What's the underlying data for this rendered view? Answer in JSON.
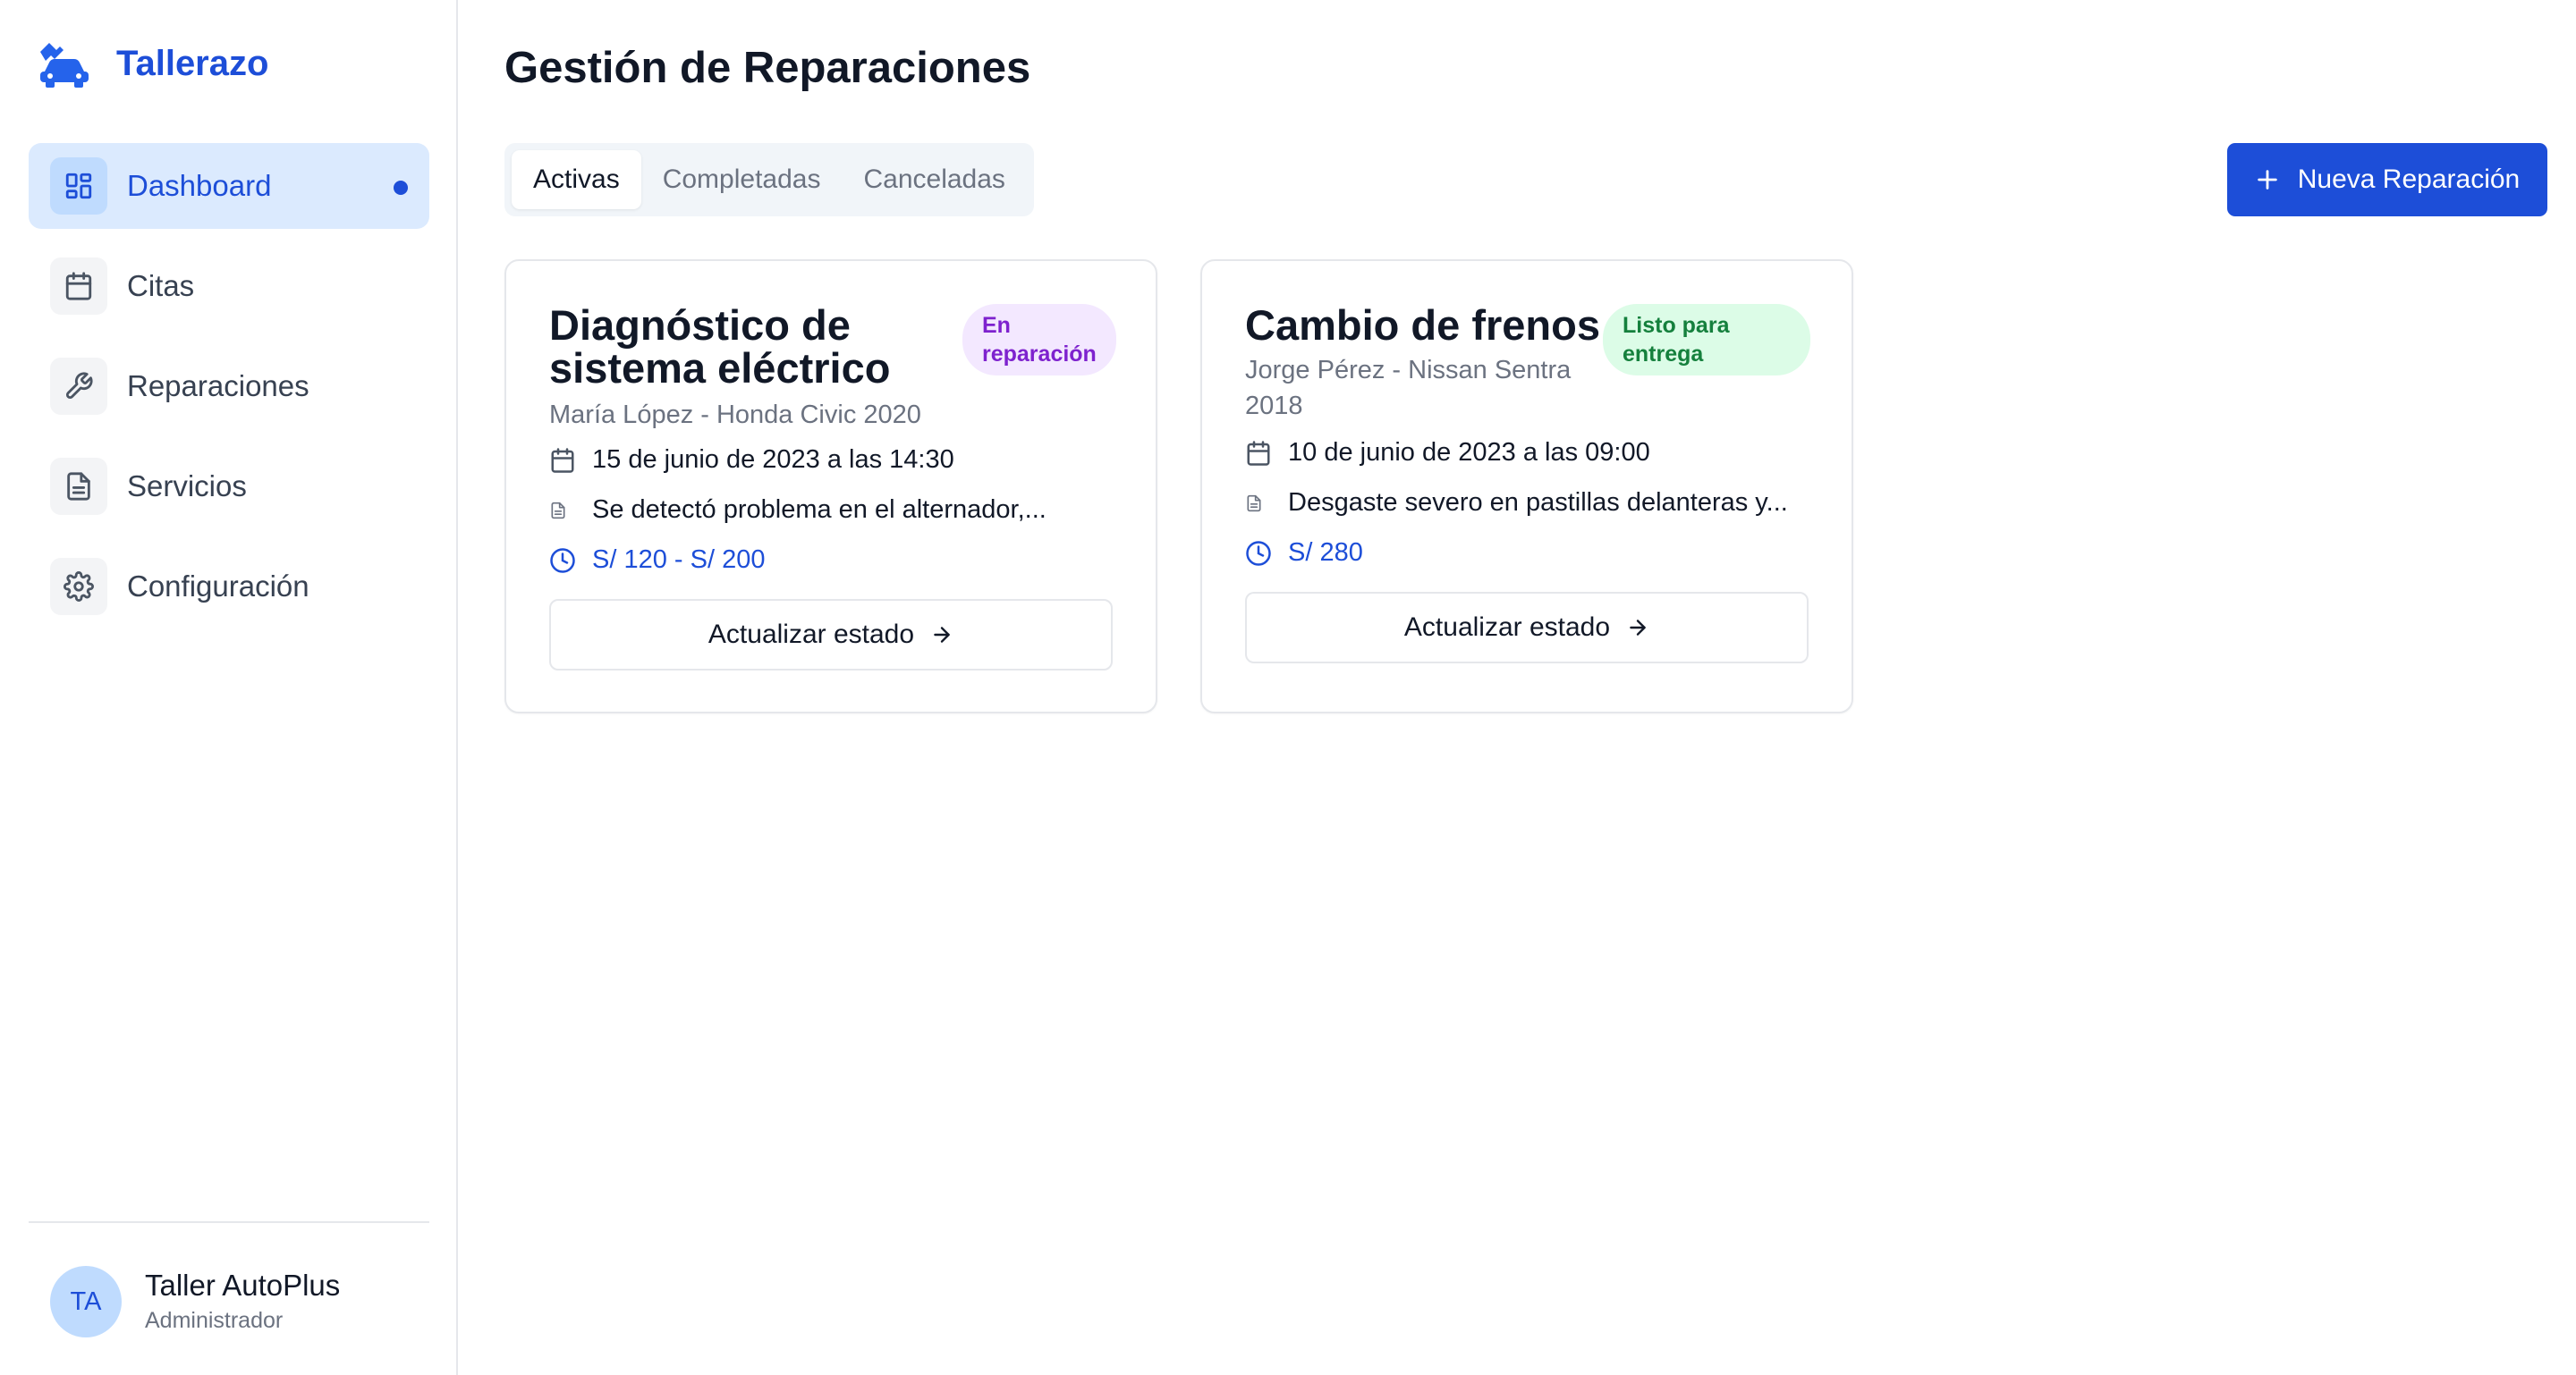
{
  "app": {
    "name": "Tallerazo",
    "logo_icon": "car-wrench-icon"
  },
  "sidebar": {
    "items": [
      {
        "label": "Dashboard",
        "icon": "dashboard-icon",
        "active": true
      },
      {
        "label": "Citas",
        "icon": "calendar-icon",
        "active": false
      },
      {
        "label": "Reparaciones",
        "icon": "wrench-icon",
        "active": false
      },
      {
        "label": "Servicios",
        "icon": "document-icon",
        "active": false
      },
      {
        "label": "Configuración",
        "icon": "gear-icon",
        "active": false
      }
    ]
  },
  "user": {
    "initials": "TA",
    "name": "Taller AutoPlus",
    "role": "Administrador"
  },
  "page": {
    "title": "Gestión de Reparaciones",
    "tabs": [
      {
        "label": "Activas",
        "active": true
      },
      {
        "label": "Completadas",
        "active": false
      },
      {
        "label": "Canceladas",
        "active": false
      }
    ],
    "new_button": "Nueva Reparación"
  },
  "repairs": [
    {
      "title_line1": "Diagnóstico de",
      "title_line2": "sistema eléctrico",
      "status_line1": "En",
      "status_line2": "reparación",
      "status_color": "#7e22ce",
      "customer_line1": "María López - Honda Civic 2020",
      "customer_line2": "",
      "date": "15 de junio de 2023 a las 14:30",
      "note": "Se detectó problema en el alternador,...",
      "price": "S/ 120 - S/ 200",
      "action": "Actualizar estado"
    },
    {
      "title_line1": "Cambio de frenos",
      "title_line2": "",
      "status_line1": "Listo para",
      "status_line2": "entrega",
      "status_color": "#15803d",
      "customer_line1": "Jorge Pérez - Nissan Sentra",
      "customer_line2": "2018",
      "date": "10 de junio de 2023 a las 09:00",
      "note": "Desgaste severo en pastillas delanteras y...",
      "price": "S/ 280",
      "action": "Actualizar estado"
    }
  ],
  "colors": {
    "accent": "#1d4ed8",
    "active_bg": "#dbeafe",
    "border": "#e5e7eb"
  }
}
